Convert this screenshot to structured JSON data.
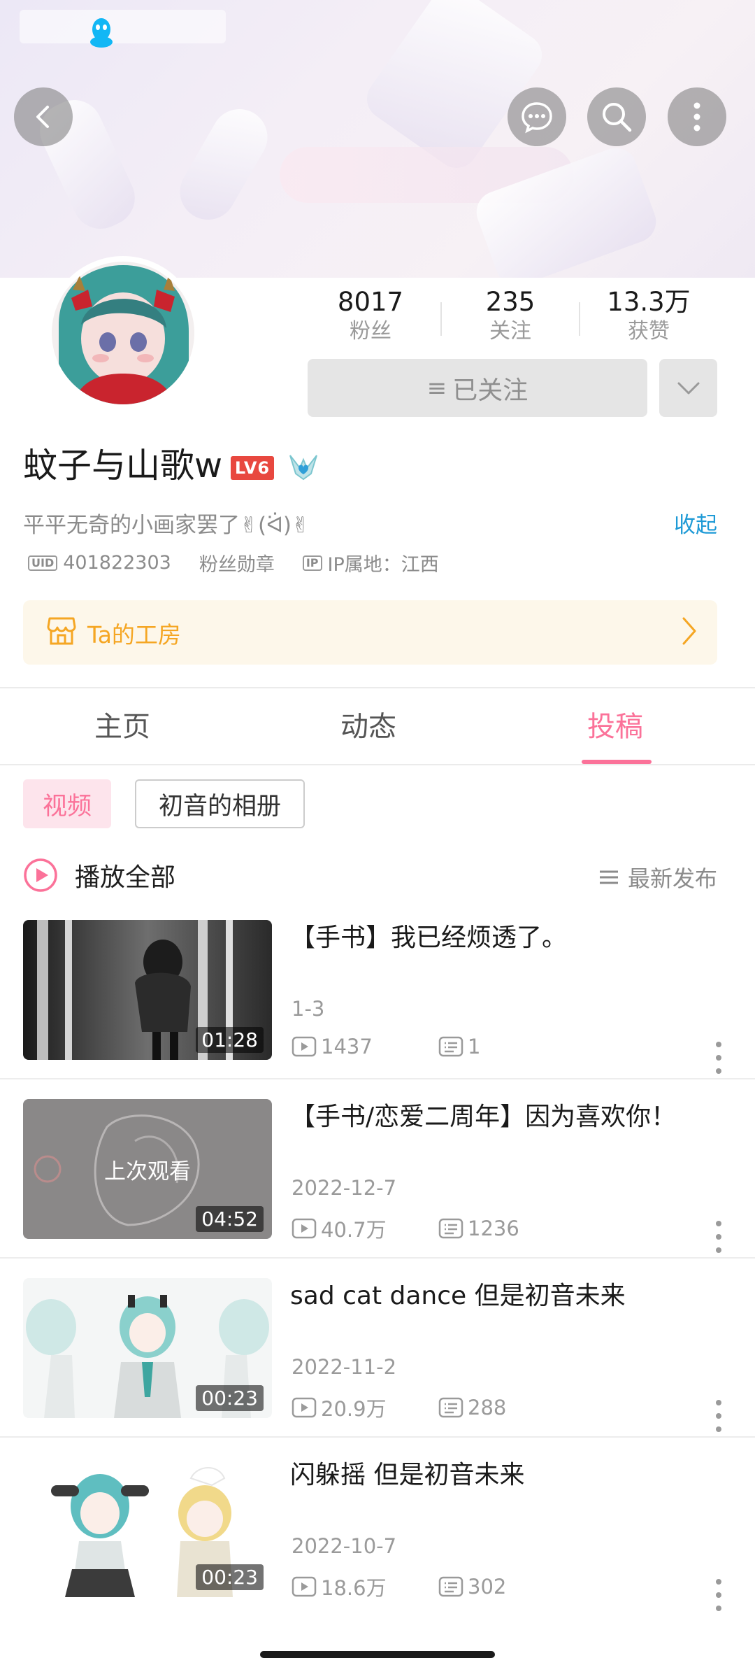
{
  "header": {
    "back_icon": "back-arrow-icon",
    "actions": [
      "message-icon",
      "search-icon",
      "more-vertical-icon"
    ]
  },
  "profile": {
    "stats": [
      {
        "value": "8017",
        "label": "粉丝"
      },
      {
        "value": "235",
        "label": "关注"
      },
      {
        "value": "13.3万",
        "label": "获赞"
      }
    ],
    "follow_label": "已关注",
    "name": "蚊子与山歌w",
    "level_badge": "LV6",
    "bio": "平平无奇的小画家罢了✌(ᐛ)✌",
    "collapse_label": "收起",
    "uid_tag": "UID",
    "uid": "401822303",
    "fan_medal": "粉丝勋章",
    "ip_tag": "IP",
    "ip_location": "IP属地：江西"
  },
  "shop": {
    "label": "Ta的工房"
  },
  "tabs": [
    {
      "label": "主页",
      "active": false
    },
    {
      "label": "动态",
      "active": false
    },
    {
      "label": "投稿",
      "active": true
    }
  ],
  "filters": {
    "video": "视频",
    "album": "初音的相册"
  },
  "list_header": {
    "play_all": "播放全部",
    "sort": "最新发布"
  },
  "videos": [
    {
      "title": "【手书】我已经烦透了。",
      "date": "1-3",
      "views": "1437",
      "comments": "1",
      "duration": "01:28",
      "overlay": ""
    },
    {
      "title": "【手书/恋爱二周年】因为喜欢你！",
      "date": "2022-12-7",
      "views": "40.7万",
      "comments": "1236",
      "duration": "04:52",
      "overlay": "上次观看"
    },
    {
      "title": "sad cat dance 但是初音未来",
      "date": "2022-11-2",
      "views": "20.9万",
      "comments": "288",
      "duration": "00:23",
      "overlay": ""
    },
    {
      "title": "闪躲摇 但是初音未来",
      "date": "2022-10-7",
      "views": "18.6万",
      "comments": "302",
      "duration": "00:23",
      "overlay": ""
    }
  ],
  "colors": {
    "accent_pink": "#fb7299",
    "link_blue": "#1e9ad6",
    "shop_orange": "#f5a623",
    "level_red": "#e8483f"
  }
}
